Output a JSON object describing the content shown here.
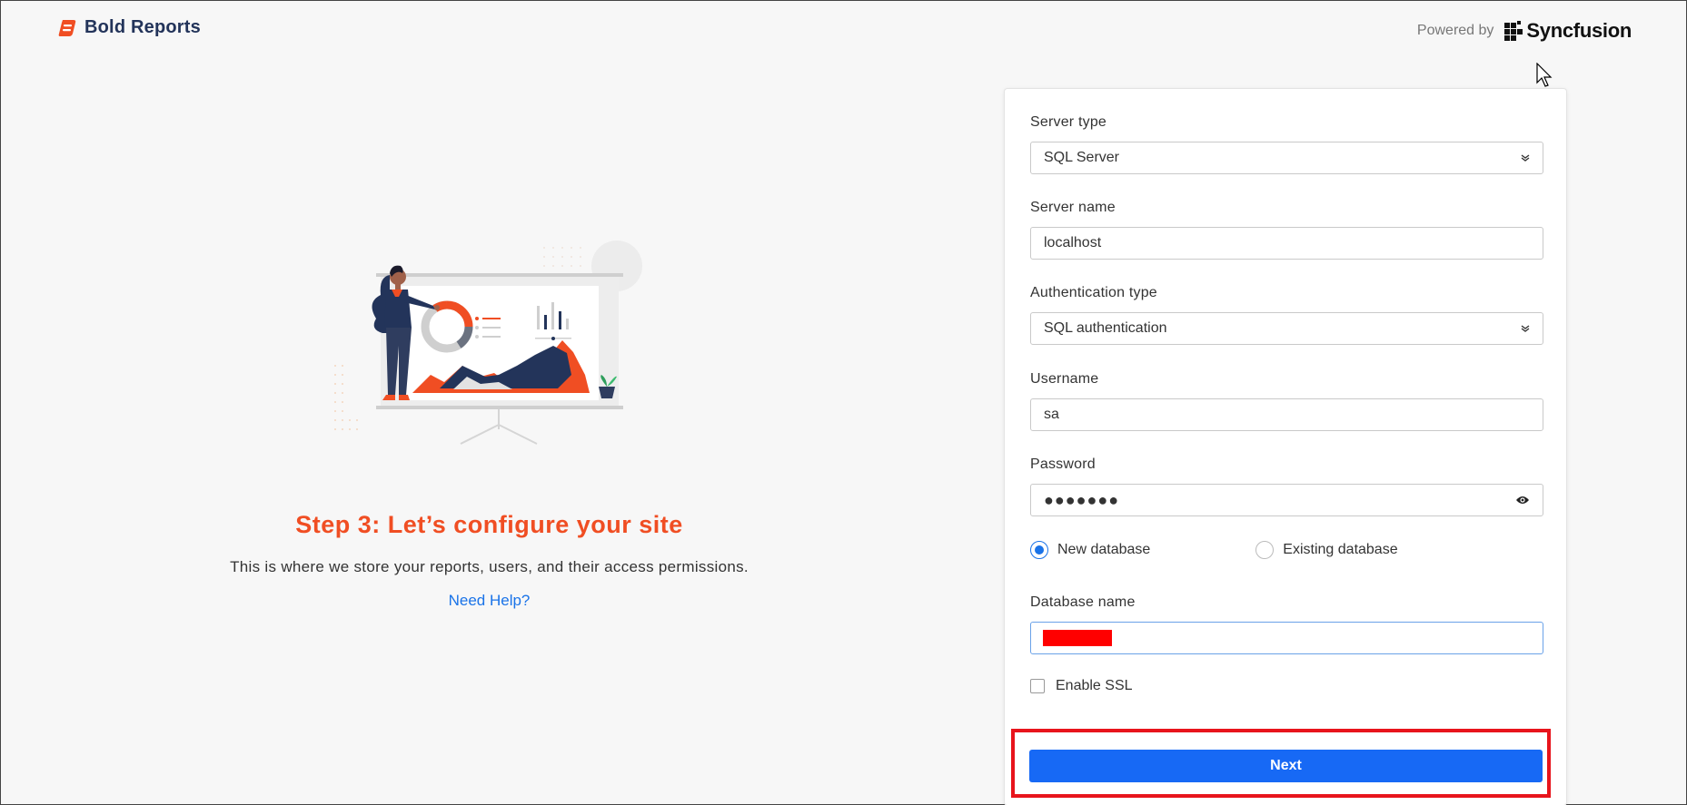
{
  "header": {
    "brand_name": "Bold Reports",
    "powered_by_label": "Powered by",
    "partner_name": "Syncfusion",
    "brand_color": "#f04e23"
  },
  "intro": {
    "title": "Step 3: Let’s configure your site",
    "description": "This is where we store your reports, users, and their access permissions.",
    "help_link": "Need Help?"
  },
  "form": {
    "server_type": {
      "label": "Server type",
      "value": "SQL Server"
    },
    "server_name": {
      "label": "Server name",
      "value": "localhost"
    },
    "auth_type": {
      "label": "Authentication type",
      "value": "SQL authentication"
    },
    "username": {
      "label": "Username",
      "value": "sa"
    },
    "password": {
      "label": "Password",
      "value": "●●●●●●●"
    },
    "database_options": [
      {
        "label": "New database",
        "selected": true
      },
      {
        "label": "Existing database",
        "selected": false
      }
    ],
    "database_name": {
      "label": "Database name",
      "value_redacted": true
    },
    "enable_ssl": {
      "label": "Enable SSL",
      "checked": false
    },
    "next_label": "Next"
  },
  "colors": {
    "accent": "#f04e23",
    "primary_button": "#1769f5",
    "link": "#1a73e8",
    "highlight": "#e8141c"
  }
}
